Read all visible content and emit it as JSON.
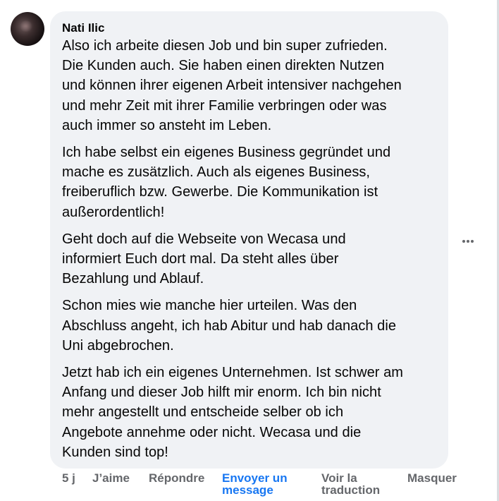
{
  "comment": {
    "author": "Nati Ilic",
    "paragraphs": [
      [
        "Also ich arbeite diesen Job und bin super zufrieden.",
        "Die Kunden auch. Sie haben einen direkten Nutzen",
        "und können ihrer eigenen Arbeit intensiver nachgehen",
        "und mehr Zeit mit ihrer Familie verbringen oder was",
        "auch immer so ansteht im Leben."
      ],
      [
        "Ich habe selbst ein eigenes Business gegründet und",
        "mache es zusätzlich. Auch als eigenes Business,",
        "freiberuflich bzw. Gewerbe. Die Kommunikation ist",
        "außerordentlich!"
      ],
      [
        "Geht doch auf die Webseite von Wecasa und",
        "informiert Euch dort mal. Da steht alles über",
        "Bezahlung und Ablauf."
      ],
      [
        "Schon mies wie manche hier urteilen. Was den",
        "Abschluss angeht, ich hab Abitur und hab danach die",
        "Uni abgebrochen."
      ],
      [
        "Jetzt hab ich ein eigenes Unternehmen. Ist schwer am",
        "Anfang und dieser Job hilft mir enorm. Ich bin nicht",
        "mehr angestellt und entscheide selber ob ich",
        "Angebote annehme oder nicht. Wecasa und die",
        "Kunden sind top!"
      ]
    ]
  },
  "actions": {
    "time": "5 j",
    "like": "J’aime",
    "reply": "Répondre",
    "message_line1": "Envoyer un",
    "message_line2": "message",
    "translate_line1": "Voir la",
    "translate_line2": "traduction",
    "hide": "Masquer"
  },
  "colors": {
    "bubble": "#f0f2f5",
    "meta_text": "#65676b",
    "accent": "#1877f2"
  }
}
